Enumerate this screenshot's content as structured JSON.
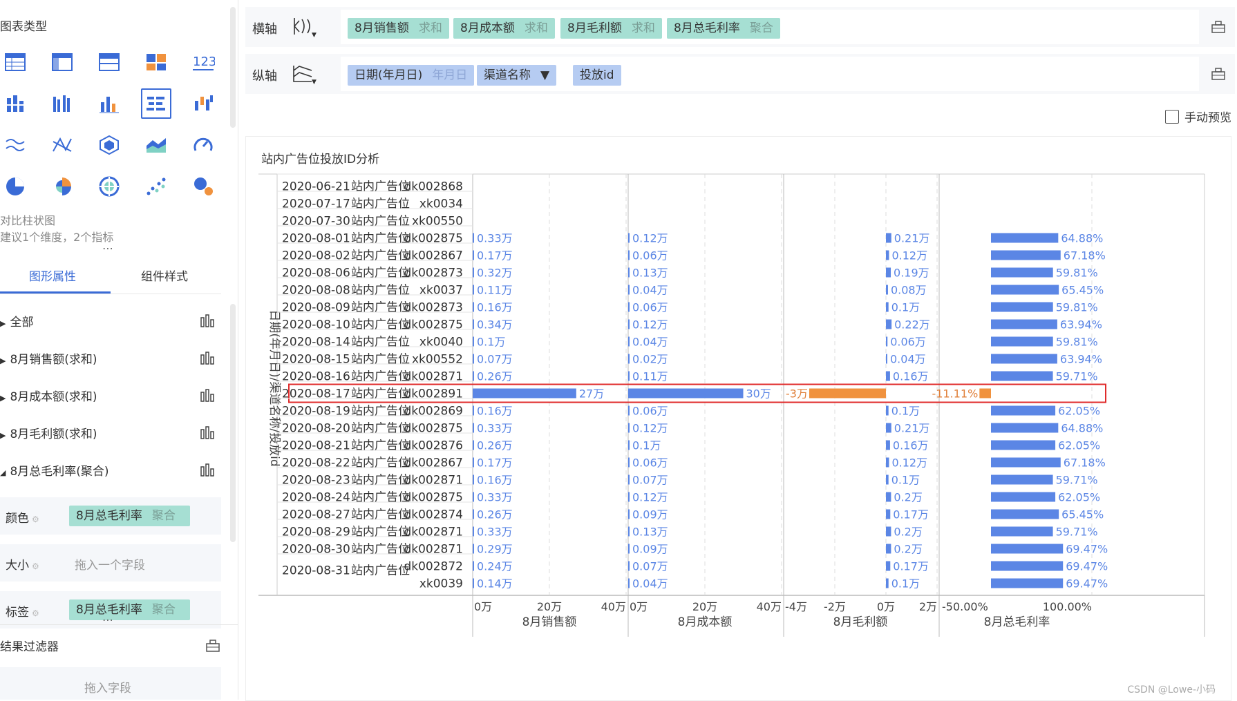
{
  "sidebar": {
    "chart_type_title": "图表类型",
    "chart_hint_name": "对比柱状图",
    "chart_hint_desc": "建议1个维度，2个指标",
    "tabs": [
      "图形属性",
      "组件样式"
    ],
    "props": [
      {
        "label": "全部",
        "expanded": false
      },
      {
        "label": "8月销售额(求和)",
        "expanded": false
      },
      {
        "label": "8月成本额(求和)",
        "expanded": false
      },
      {
        "label": "8月毛利额(求和)",
        "expanded": false
      },
      {
        "label": "8月总毛利率(聚合)",
        "expanded": true
      }
    ],
    "color_label": "颜色",
    "color_field": {
      "name": "8月总毛利率",
      "agg": "聚合"
    },
    "size_label": "大小",
    "size_placeholder": "拖入一个字段",
    "tag_label": "标签",
    "tag_field": {
      "name": "8月总毛利率",
      "agg": "聚合"
    },
    "result_filter": "结果过滤器",
    "drop_field": "拖入字段"
  },
  "toolbar": {
    "x_axis_label": "横轴",
    "y_axis_label": "纵轴",
    "x_fields": [
      {
        "name": "8月销售额",
        "agg": "求和"
      },
      {
        "name": "8月成本额",
        "agg": "求和"
      },
      {
        "name": "8月毛利额",
        "agg": "求和"
      },
      {
        "name": "8月总毛利率",
        "agg": "聚合"
      }
    ],
    "y_fields": [
      {
        "name": "日期(年月日)",
        "agg": "年月日"
      },
      {
        "name": "渠道名称",
        "agg": "▼"
      },
      {
        "name": "投放id",
        "agg": ""
      }
    ],
    "manual_preview": "手动预览"
  },
  "chart": {
    "title": "站内广告位投放ID分析",
    "y_axis_title": "日期(年月日)/渠道名称/投放id",
    "watermark": "CSDN @Lowe-小码",
    "colors": {
      "bar": "#5b86e5",
      "negative": "#f0923e",
      "label": "#5b86e5",
      "neg_label": "#e0803a",
      "highlight": "#e02b2b"
    },
    "panels": [
      {
        "title": "8月销售额",
        "ticks": [
          "0万",
          "20万",
          "40万"
        ]
      },
      {
        "title": "8月成本额",
        "ticks": [
          "0万",
          "20万",
          "40万"
        ]
      },
      {
        "title": "8月毛利额",
        "ticks": [
          "-4万",
          "-2万",
          "0万",
          "2万"
        ]
      },
      {
        "title": "8月总毛利率",
        "ticks": [
          "-50.00%",
          "100.00%"
        ]
      }
    ]
  },
  "chart_data": {
    "type": "bar",
    "channel": "站内广告位",
    "rows": [
      {
        "date": "2020-06-21",
        "id": "dk002868",
        "sales": null,
        "cost": null,
        "profit": null,
        "rate": null,
        "sales_l": "",
        "cost_l": "",
        "profit_l": "",
        "rate_l": ""
      },
      {
        "date": "2020-07-17",
        "id": "xk0034",
        "sales": null,
        "cost": null,
        "profit": null,
        "rate": null,
        "sales_l": "",
        "cost_l": "",
        "profit_l": "",
        "rate_l": ""
      },
      {
        "date": "2020-07-30",
        "id": "xk00550",
        "sales": null,
        "cost": null,
        "profit": null,
        "rate": null,
        "sales_l": "",
        "cost_l": "",
        "profit_l": "",
        "rate_l": ""
      },
      {
        "date": "2020-08-01",
        "id": "dk002875",
        "sales": 0.33,
        "cost": 0.12,
        "profit": 0.21,
        "rate": 64.88,
        "sales_l": "0.33万",
        "cost_l": "0.12万",
        "profit_l": "0.21万",
        "rate_l": "64.88%"
      },
      {
        "date": "2020-08-02",
        "id": "dk002867",
        "sales": 0.17,
        "cost": 0.06,
        "profit": 0.12,
        "rate": 67.18,
        "sales_l": "0.17万",
        "cost_l": "0.06万",
        "profit_l": "0.12万",
        "rate_l": "67.18%"
      },
      {
        "date": "2020-08-06",
        "id": "dk002873",
        "sales": 0.32,
        "cost": 0.13,
        "profit": 0.19,
        "rate": 59.81,
        "sales_l": "0.32万",
        "cost_l": "0.13万",
        "profit_l": "0.19万",
        "rate_l": "59.81%"
      },
      {
        "date": "2020-08-08",
        "id": "xk0037",
        "sales": 0.11,
        "cost": 0.04,
        "profit": 0.08,
        "rate": 65.45,
        "sales_l": "0.11万",
        "cost_l": "0.04万",
        "profit_l": "0.08万",
        "rate_l": "65.45%"
      },
      {
        "date": "2020-08-09",
        "id": "dk002873",
        "sales": 0.16,
        "cost": 0.06,
        "profit": 0.1,
        "rate": 59.81,
        "sales_l": "0.16万",
        "cost_l": "0.06万",
        "profit_l": "0.1万",
        "rate_l": "59.81%"
      },
      {
        "date": "2020-08-10",
        "id": "dk002875",
        "sales": 0.34,
        "cost": 0.12,
        "profit": 0.22,
        "rate": 63.94,
        "sales_l": "0.34万",
        "cost_l": "0.12万",
        "profit_l": "0.22万",
        "rate_l": "63.94%"
      },
      {
        "date": "2020-08-14",
        "id": "xk0040",
        "sales": 0.1,
        "cost": 0.04,
        "profit": 0.06,
        "rate": 59.81,
        "sales_l": "0.1万",
        "cost_l": "0.04万",
        "profit_l": "0.06万",
        "rate_l": "59.81%"
      },
      {
        "date": "2020-08-15",
        "id": "xk00552",
        "sales": 0.07,
        "cost": 0.02,
        "profit": 0.04,
        "rate": 63.94,
        "sales_l": "0.07万",
        "cost_l": "0.02万",
        "profit_l": "0.04万",
        "rate_l": "63.94%"
      },
      {
        "date": "2020-08-16",
        "id": "dk002871",
        "sales": 0.26,
        "cost": 0.11,
        "profit": 0.16,
        "rate": 59.71,
        "sales_l": "0.26万",
        "cost_l": "0.11万",
        "profit_l": "0.16万",
        "rate_l": "59.71%"
      },
      {
        "date": "2020-08-17",
        "id": "dk002891",
        "sales": 27,
        "cost": 30,
        "profit": -3,
        "rate": -11.11,
        "sales_l": "27万",
        "cost_l": "30万",
        "profit_l": "-3万",
        "rate_l": "-11.11%",
        "highlight": true
      },
      {
        "date": "2020-08-19",
        "id": "dk002869",
        "sales": 0.16,
        "cost": 0.06,
        "profit": 0.1,
        "rate": 62.05,
        "sales_l": "0.16万",
        "cost_l": "0.06万",
        "profit_l": "0.1万",
        "rate_l": "62.05%"
      },
      {
        "date": "2020-08-20",
        "id": "dk002875",
        "sales": 0.33,
        "cost": 0.12,
        "profit": 0.21,
        "rate": 64.88,
        "sales_l": "0.33万",
        "cost_l": "0.12万",
        "profit_l": "0.21万",
        "rate_l": "64.88%"
      },
      {
        "date": "2020-08-21",
        "id": "dk002876",
        "sales": 0.26,
        "cost": 0.1,
        "profit": 0.16,
        "rate": 62.05,
        "sales_l": "0.26万",
        "cost_l": "0.1万",
        "profit_l": "0.16万",
        "rate_l": "62.05%"
      },
      {
        "date": "2020-08-22",
        "id": "dk002867",
        "sales": 0.17,
        "cost": 0.06,
        "profit": 0.12,
        "rate": 67.18,
        "sales_l": "0.17万",
        "cost_l": "0.06万",
        "profit_l": "0.12万",
        "rate_l": "67.18%"
      },
      {
        "date": "2020-08-23",
        "id": "dk002871",
        "sales": 0.16,
        "cost": 0.07,
        "profit": 0.1,
        "rate": 59.71,
        "sales_l": "0.16万",
        "cost_l": "0.07万",
        "profit_l": "0.1万",
        "rate_l": "59.71%"
      },
      {
        "date": "2020-08-24",
        "id": "dk002875",
        "sales": 0.33,
        "cost": 0.12,
        "profit": 0.2,
        "rate": 62.05,
        "sales_l": "0.33万",
        "cost_l": "0.12万",
        "profit_l": "0.2万",
        "rate_l": "62.05%"
      },
      {
        "date": "2020-08-27",
        "id": "dk002874",
        "sales": 0.26,
        "cost": 0.09,
        "profit": 0.17,
        "rate": 65.45,
        "sales_l": "0.26万",
        "cost_l": "0.09万",
        "profit_l": "0.17万",
        "rate_l": "65.45%"
      },
      {
        "date": "2020-08-29",
        "id": "dk002871",
        "sales": 0.33,
        "cost": 0.13,
        "profit": 0.2,
        "rate": 59.71,
        "sales_l": "0.33万",
        "cost_l": "0.13万",
        "profit_l": "0.2万",
        "rate_l": "59.71%"
      },
      {
        "date": "2020-08-30",
        "id": "dk002871",
        "sales": 0.29,
        "cost": 0.09,
        "profit": 0.2,
        "rate": 69.47,
        "sales_l": "0.29万",
        "cost_l": "0.09万",
        "profit_l": "0.2万",
        "rate_l": "69.47%"
      },
      {
        "date": "2020-08-31",
        "id": "dk002872",
        "sales": 0.24,
        "cost": 0.07,
        "profit": 0.17,
        "rate": 69.47,
        "sales_l": "0.24万",
        "cost_l": "0.07万",
        "profit_l": "0.17万",
        "rate_l": "69.47%",
        "group_start": true
      },
      {
        "date": "",
        "id": "xk0039",
        "sales": 0.14,
        "cost": 0.04,
        "profit": 0.1,
        "rate": 69.47,
        "sales_l": "0.14万",
        "cost_l": "0.04万",
        "profit_l": "0.1万",
        "rate_l": "69.47%",
        "group_cont": true
      }
    ],
    "xlim": {
      "sales": [
        0,
        40
      ],
      "cost": [
        0,
        40
      ],
      "profit": [
        -4,
        2
      ],
      "rate": [
        -50,
        100
      ]
    }
  }
}
